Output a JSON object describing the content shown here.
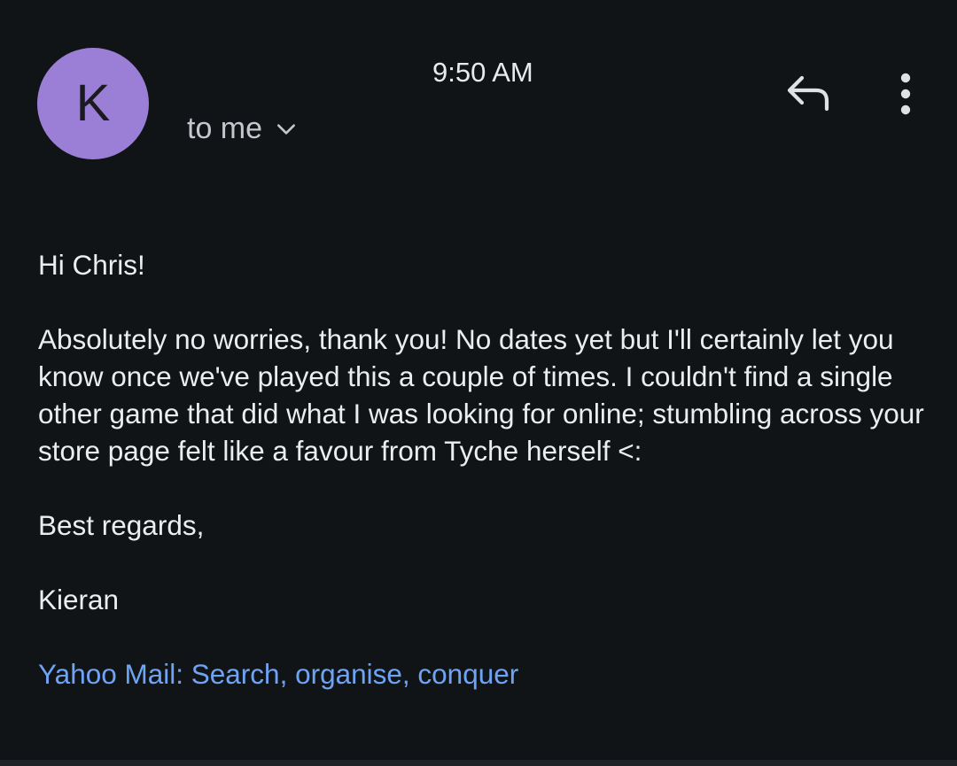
{
  "sender": {
    "avatar_initial": "K",
    "avatar_color": "#9b7fd6"
  },
  "header": {
    "time": "9:50 AM",
    "recipient_label": "to me",
    "icons": {
      "recipient_toggle": "chevron-down-icon",
      "reply": "reply-icon",
      "more": "more-vertical-icon"
    }
  },
  "message": {
    "greeting": "Hi Chris!",
    "paragraph": "Absolutely no worries, thank you! No dates yet but I'll certainly let you know once we've played this a couple of times. I couldn't find a single other game that did what I was looking for online; stumbling across your store page felt like a favour from Tyche herself <:",
    "signoff": "Best regards,",
    "signature": "Kieran",
    "footer_link": "Yahoo Mail: Search, organise, conquer"
  },
  "colors": {
    "background": "#111417",
    "text": "#ecedef",
    "link": "#6fa4f5"
  }
}
